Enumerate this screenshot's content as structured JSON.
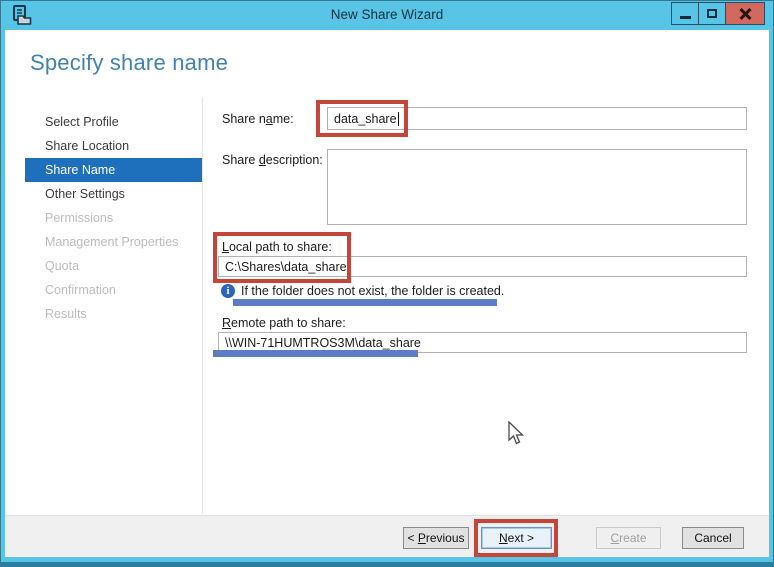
{
  "window": {
    "title": "New Share Wizard",
    "icons": {
      "app": "share-wizard-icon",
      "minimize": "minimize-icon",
      "maximize": "maximize-icon",
      "close": "close-icon",
      "info": "info-icon",
      "cursor": "mouse-cursor"
    }
  },
  "heading": "Specify share name",
  "sidebar": {
    "items": [
      {
        "label": "Select Profile",
        "state": "enabled"
      },
      {
        "label": "Share Location",
        "state": "enabled"
      },
      {
        "label": "Share Name",
        "state": "selected"
      },
      {
        "label": "Other Settings",
        "state": "enabled"
      },
      {
        "label": "Permissions",
        "state": "disabled"
      },
      {
        "label": "Management Properties",
        "state": "disabled"
      },
      {
        "label": "Quota",
        "state": "disabled"
      },
      {
        "label": "Confirmation",
        "state": "disabled"
      },
      {
        "label": "Results",
        "state": "disabled"
      }
    ]
  },
  "form": {
    "share_name": {
      "label_pre": "Share n",
      "label_key": "a",
      "label_post": "me:",
      "value": "data_share"
    },
    "share_description": {
      "label_pre": "Share ",
      "label_key": "d",
      "label_post": "escription:",
      "value": ""
    },
    "local_path": {
      "label_pre": "",
      "label_key": "L",
      "label_post": "ocal path to share:",
      "value": "C:\\Shares\\data_share"
    },
    "info_text": "If the folder does not exist, the folder is created.",
    "remote_path": {
      "label_pre": "",
      "label_key": "R",
      "label_post": "emote path to share:",
      "value": "\\\\WIN-71HUMTROS3M\\data_share"
    }
  },
  "footer": {
    "previous": {
      "pre": "< ",
      "key": "P",
      "post": "revious"
    },
    "next": {
      "pre": "",
      "key": "N",
      "post": "ext >"
    },
    "create": {
      "pre": "",
      "key": "C",
      "post": "reate"
    },
    "cancel_label": "Cancel"
  },
  "colors": {
    "titlebar": "#58c5e7",
    "accent_selected": "#1e70bc",
    "heading": "#4182b0",
    "annotation_red": "#c5453b",
    "annotation_blue": "#5b7dc4",
    "close_button": "#d2695e",
    "bottom_strip": "#2b7e9e"
  }
}
